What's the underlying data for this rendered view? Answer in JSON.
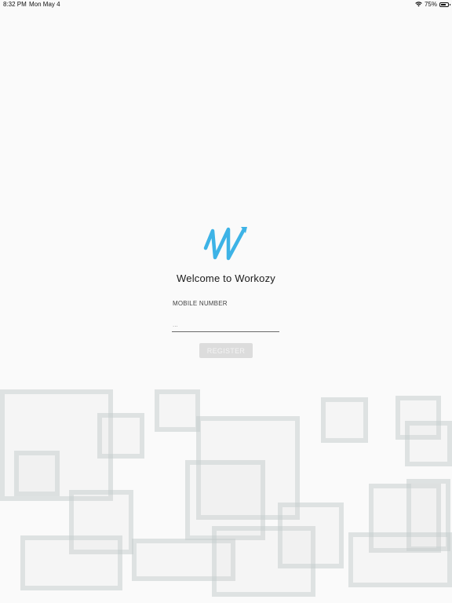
{
  "status_bar": {
    "time": "8:32 PM",
    "date": "Mon May 4",
    "battery_percent": "75%",
    "battery_level": 0.75,
    "wifi_icon": "wifi-icon",
    "battery_icon": "battery-icon"
  },
  "brand": {
    "logo_icon": "workozy-logo-icon",
    "accent_color": "#3db3e6"
  },
  "welcome_text": "Welcome to Workozy",
  "form": {
    "mobile_label": "MOBILE NUMBER",
    "mobile_placeholder": "...",
    "mobile_value": "",
    "register_label": "REGISTER",
    "register_enabled": false
  }
}
